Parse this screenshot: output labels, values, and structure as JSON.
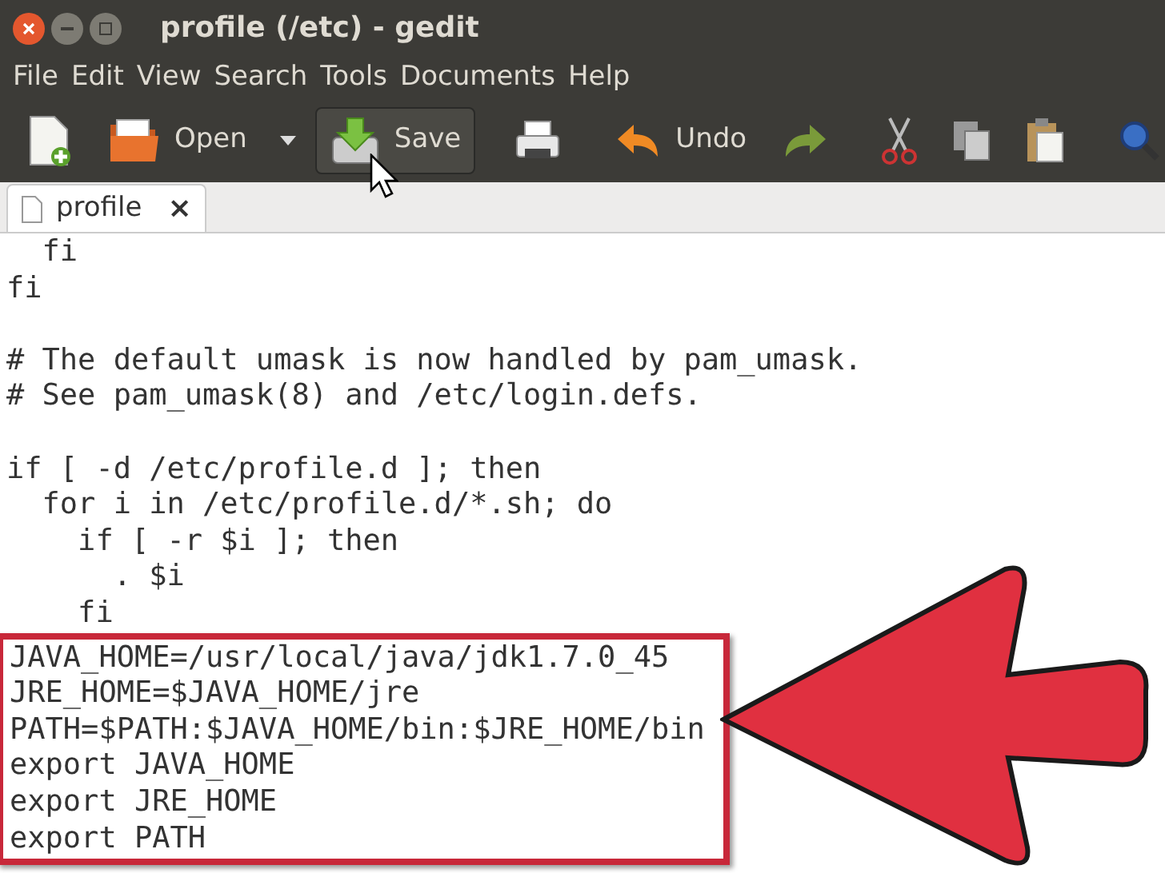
{
  "window": {
    "title": "profile (/etc) - gedit"
  },
  "menu": [
    "File",
    "Edit",
    "View",
    "Search",
    "Tools",
    "Documents",
    "Help"
  ],
  "toolbar": [
    {
      "kind": "new"
    },
    {
      "kind": "open",
      "label": "Open"
    },
    {
      "kind": "dropdown"
    },
    {
      "kind": "save",
      "label": "Save",
      "hovered": true
    },
    {
      "kind": "print"
    },
    {
      "kind": "undo",
      "label": "Undo"
    },
    {
      "kind": "redo"
    },
    {
      "kind": "cut"
    },
    {
      "kind": "copy"
    },
    {
      "kind": "paste"
    },
    {
      "kind": "find"
    }
  ],
  "tabs": [
    {
      "label": "profile",
      "close": "×",
      "selected": true
    }
  ],
  "lines": [
    {
      "kind": "code",
      "text": "  fi",
      "highlighted": false
    },
    {
      "kind": "code",
      "text": "fi",
      "highlighted": false
    },
    {
      "kind": "blank"
    },
    {
      "kind": "code",
      "text": "# The default umask is now handled by pam_umask.",
      "highlighted": false
    },
    {
      "kind": "code",
      "text": "# See pam_umask(8) and /etc/login.defs.",
      "highlighted": false
    },
    {
      "kind": "blank"
    },
    {
      "kind": "code",
      "text": "if [ -d /etc/profile.d ]; then",
      "highlighted": false
    },
    {
      "kind": "code",
      "text": "  for i in /etc/profile.d/*.sh; do",
      "highlighted": false
    },
    {
      "kind": "code",
      "text": "    if [ -r $i ]; then",
      "highlighted": false
    },
    {
      "kind": "code",
      "text": "      . $i",
      "highlighted": false
    },
    {
      "kind": "code",
      "text": "    fi",
      "highlighted": false
    },
    {
      "kind": "code",
      "text": "JAVA_HOME=/usr/local/java/jdk1.7.0_45",
      "highlighted": true
    },
    {
      "kind": "code",
      "text": "JRE_HOME=$JAVA_HOME/jre",
      "highlighted": true
    },
    {
      "kind": "code",
      "text": "PATH=$PATH:$JAVA_HOME/bin:$JRE_HOME/bin",
      "highlighted": true
    },
    {
      "kind": "code",
      "text": "export JAVA_HOME",
      "highlighted": true
    },
    {
      "kind": "code",
      "text": "export JRE_HOME",
      "highlighted": true
    },
    {
      "kind": "code",
      "text": "export PATH",
      "highlighted": true
    }
  ]
}
